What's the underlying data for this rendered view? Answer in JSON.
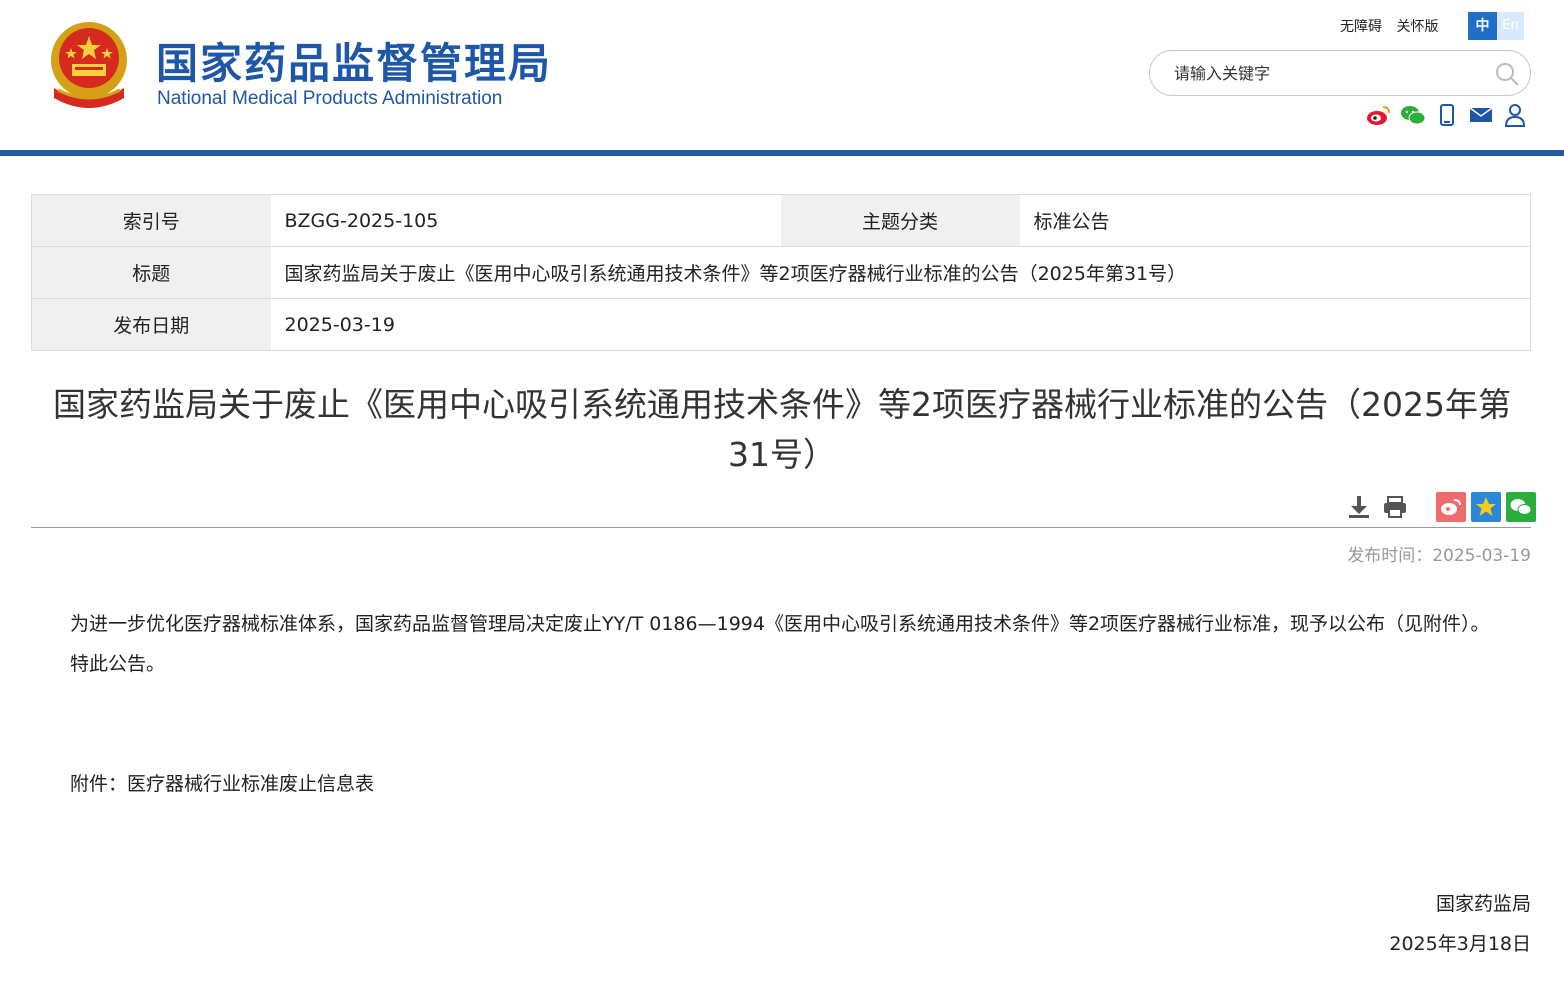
{
  "header": {
    "brand_cn": "国家药品监督管理局",
    "brand_en": "National Medical Products Administration",
    "links": [
      "无障碍",
      "关怀版"
    ],
    "lang_zh": "中",
    "lang_en": "En",
    "search_placeholder": "请输入关键字",
    "social_icons": [
      "weibo-icon",
      "wechat-icon",
      "mobile-icon",
      "mail-icon",
      "user-icon"
    ],
    "colors": {
      "brand": "#1f57a8",
      "rule": "#2657a8",
      "lang_active": "#1f6fc7"
    }
  },
  "meta": {
    "index_label": "索引号",
    "index_value": "BZGG-2025-105",
    "category_label": "主题分类",
    "category_value": "标准公告",
    "title_label": "标题",
    "title_value": "国家药监局关于废止《医用中心吸引系统通用技术条件》等2项医疗器械行业标准的公告（2025年第31号）",
    "date_label": "发布日期",
    "date_value": "2025-03-19"
  },
  "article": {
    "title": "国家药监局关于废止《医用中心吸引系统通用技术条件》等2项医疗器械行业标准的公告（2025年第31号）",
    "tools": [
      "download-icon",
      "print-icon",
      "share-weibo-icon",
      "share-qzone-icon",
      "share-wechat-icon"
    ],
    "pub_time": "发布时间：2025-03-19",
    "para1": "为进一步优化医疗器械标准体系，国家药品监督管理局决定废止YY/T 0186—1994《医用中心吸引系统通用技术条件》等2项医疗器械行业标准，现予以公布（见附件）。",
    "para2": "特此公告。",
    "attachment": "附件：医疗器械行业标准废止信息表",
    "signer": "国家药监局",
    "sign_date": "2025年3月18日"
  }
}
